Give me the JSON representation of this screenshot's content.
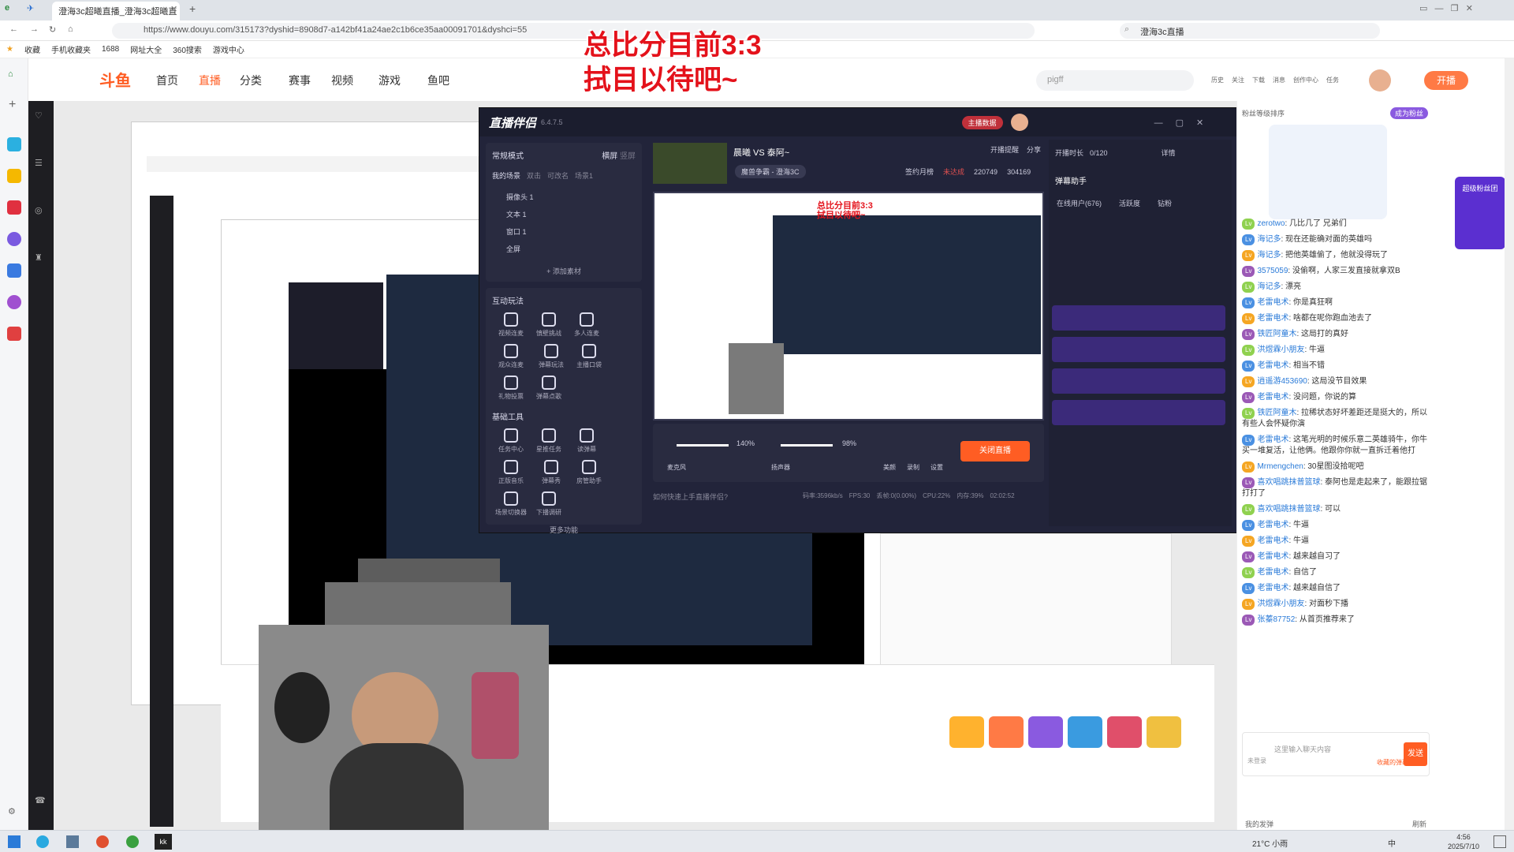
{
  "browser": {
    "tab_title": "澄海3c超曦直播_澄海3c超曦直",
    "url": "https://www.douyu.com/315173?dyshid=8908d7-a142bf41a24ae2c1b6ce35aa00091701&dyshci=55",
    "search_text": "澄海3c直播",
    "bookmarks": [
      "收藏",
      "手机收藏夹",
      "1688",
      "网址大全",
      "360搜索",
      "游戏中心"
    ]
  },
  "nav": {
    "logo": "斗鱼",
    "items": [
      "首页",
      "直播",
      "分类",
      "赛事",
      "视频",
      "游戏",
      "鱼吧"
    ],
    "search_placeholder": "pigff",
    "right": [
      "历史",
      "关注",
      "下载",
      "消息",
      "创作中心",
      "任务"
    ],
    "live_button": "开播"
  },
  "overlay": {
    "line1": "总比分目前3:3",
    "line2": "拭目以待吧~"
  },
  "obs": {
    "app_title": "直播伴侣",
    "version": "6.4.7.5",
    "mode": "常规模式",
    "screen_tabs": [
      "横屏",
      "竖屏"
    ],
    "scene_tabs": [
      "我的场景",
      "双击",
      "可改名",
      "场景1"
    ],
    "sources": [
      "摄像头 1",
      "文本 1",
      "窗口 1",
      "全屏"
    ],
    "add_source": "+ 添加素材",
    "stream_title": "晨曦 VS 泰阿~",
    "category": "魔兽争霸 - 澄海3C",
    "stats": {
      "sign": "签约月榜",
      "sign_status": "未达成",
      "fans": "220749",
      "likes": "304169"
    },
    "interactive_title": "互动玩法",
    "interactive": [
      "视频连麦",
      "慎壁挑战",
      "多人连麦",
      "观众连麦",
      "弹幕玩法",
      "主播口袋",
      "礼物投票",
      "弹幕点歌"
    ],
    "basic_title": "基础工具",
    "basic": [
      "任务中心",
      "星推任务",
      "读弹幕",
      "正版音乐",
      "弹幕秀",
      "房管助手",
      "场景切换器",
      "下播调研"
    ],
    "more": "更多功能",
    "mic_label": "麦克风",
    "mic_value": "140%",
    "speaker_label": "扬声器",
    "speaker_value": "98%",
    "beauty_label": "美颜",
    "record_label": "录制",
    "settings_label": "设置",
    "end_button": "关闭直播",
    "help": "如何快速上手直播伴侣?",
    "status": [
      "码率:3596kb/s",
      "FPS:30",
      "丢帧:0(0.00%)",
      "CPU:22%",
      "内存:39%",
      "02:02:52"
    ],
    "top_buttons": [
      "主播数据",
      "开播提醒",
      "分享"
    ],
    "barrage_title": "弹幕助手",
    "barrage_tabs": [
      "在线用户(676)",
      "活跃度",
      "钻粉"
    ],
    "live_time": "开播时长",
    "heat": "0/120",
    "details": "详情"
  },
  "chat": {
    "header": "粉丝等级排序",
    "activity": "超级粉丝团",
    "messages": [
      {
        "user": "zerotwo",
        "text": "几比几了 兄弟们"
      },
      {
        "user": "海记多",
        "text": "现在还能确对面的英雄吗"
      },
      {
        "user": "海记多",
        "text": "把他英雄偷了，他就没得玩了"
      },
      {
        "user": "3575059",
        "text": "没偷啊，人家三发直接就拿双B"
      },
      {
        "user": "海记多",
        "text": "漂亮"
      },
      {
        "user": "老雷电术",
        "text": "你是真狂啊"
      },
      {
        "user": "老雷电术",
        "text": "啥都在呢你跑血池去了"
      },
      {
        "user": "铁匠阿童木",
        "text": "这局打的真好"
      },
      {
        "user": "洪煜霖小朋友",
        "text": "牛逼"
      },
      {
        "user": "老雷电术",
        "text": "相当不错"
      },
      {
        "user": "逍遥游453690",
        "text": "这局没节目效果"
      },
      {
        "user": "老雷电术",
        "text": "没问题，你说的算"
      },
      {
        "user": "铁匠阿童木",
        "text": "拉稀状态好坏差距还是挺大的，所以有些人会怀疑你演"
      },
      {
        "user": "老雷电术",
        "text": "这笔光明的时候乐意二英雄骑牛，你牛买一堆复活，让他俩。他跟你你就一直拆迁着他打"
      },
      {
        "user": "Mrmengchen",
        "text": "30星图没拾呢吧"
      },
      {
        "user": "喜欢唱跳抹普篮球",
        "text": "泰阿也是走起来了，能跟拉锯打打了"
      },
      {
        "user": "喜欢唱跳抹普篮球",
        "text": "可以"
      },
      {
        "user": "老雷电术",
        "text": "牛逼"
      },
      {
        "user": "老雷电术",
        "text": "牛逼"
      },
      {
        "user": "老雷电术",
        "text": "越来越自习了"
      },
      {
        "user": "老雷电术",
        "text": "自信了"
      },
      {
        "user": "老雷电术",
        "text": "越来越自信了"
      },
      {
        "user": "洪煜霖小朋友",
        "text": "对面秒下播"
      },
      {
        "user": "张蓁87752",
        "text": "从首页推荐来了"
      }
    ],
    "input_placeholder": "这里输入聊天内容",
    "send": "发送",
    "send_hint": "收藏的弹幕",
    "not_logged": "未登录",
    "my_barrage": "我的发弹",
    "refresh": "刷新"
  },
  "taskbar": {
    "weather": "21°C 小雨",
    "time": "4:56",
    "date": "2025/7/10",
    "lang": "中"
  }
}
